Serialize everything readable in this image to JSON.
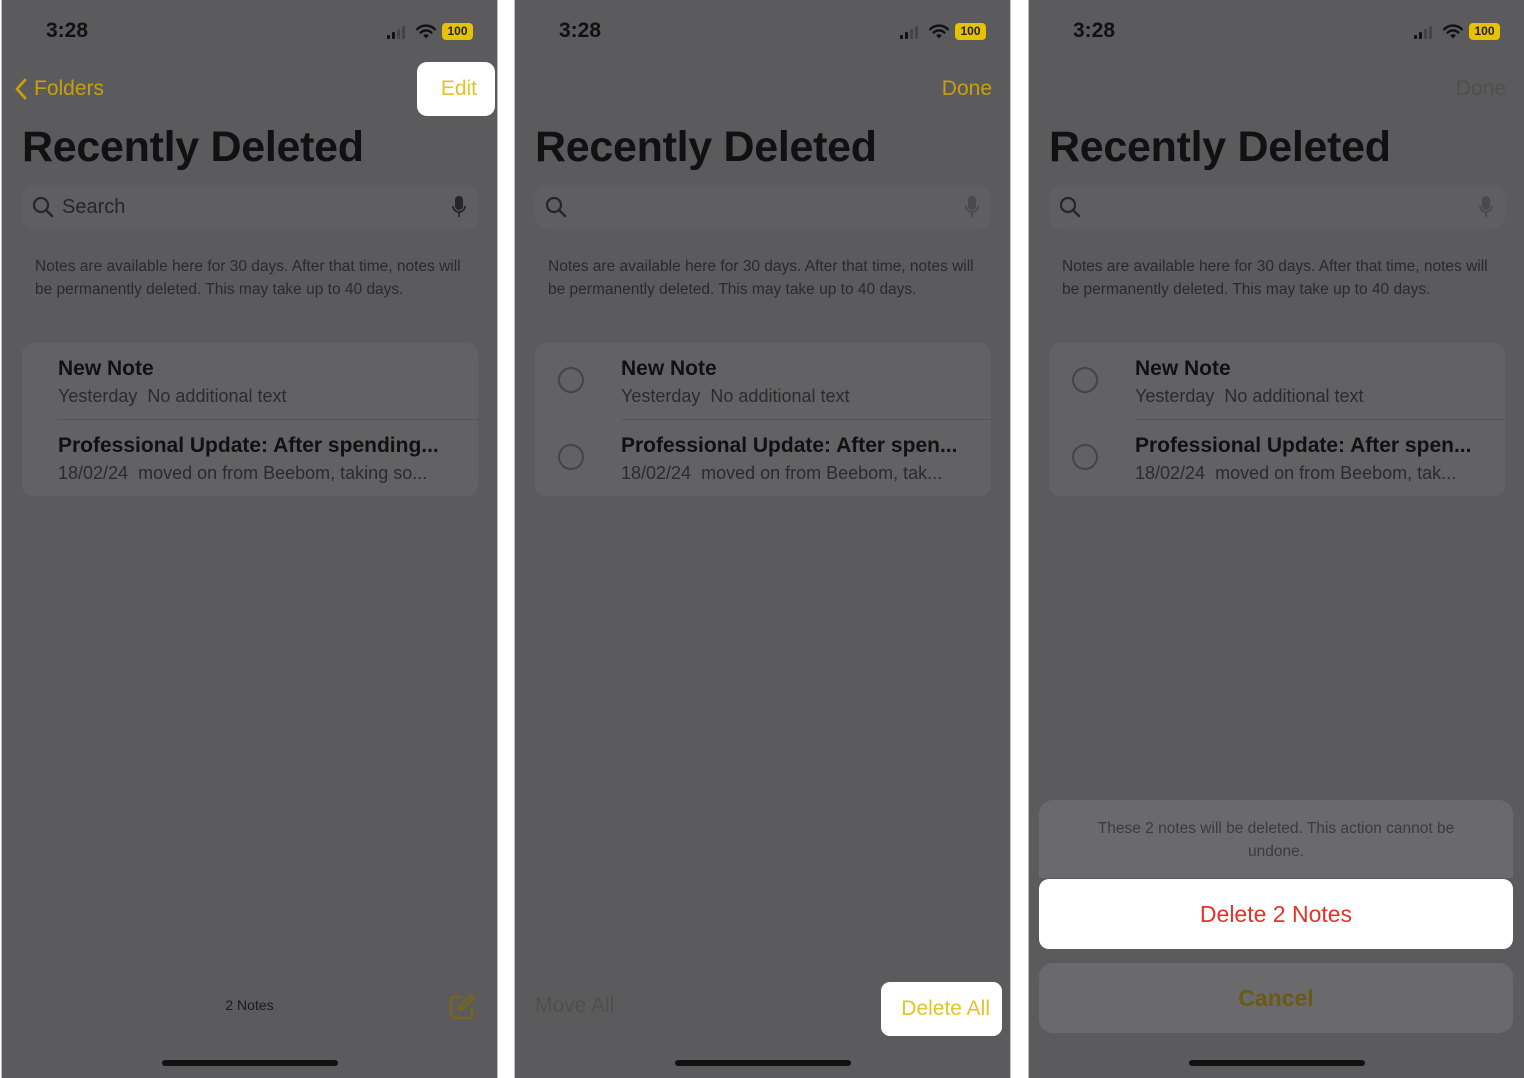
{
  "status": {
    "time": "3:28",
    "battery": "100"
  },
  "nav": {
    "back_label": "Folders",
    "edit_label": "Edit",
    "done_label": "Done"
  },
  "page": {
    "title": "Recently Deleted",
    "search_placeholder": "Search",
    "info_text": "Notes are available here for 30 days. After that time, notes will be permanently deleted. This may take up to 40 days."
  },
  "notes_full": [
    {
      "title": "New Note",
      "date": "Yesterday",
      "preview": "No additional text"
    },
    {
      "title": "Professional Update: After spending...",
      "date": "18/02/24",
      "preview": "moved on from Beebom, taking so..."
    }
  ],
  "notes_edit": [
    {
      "title": "New Note",
      "date": "Yesterday",
      "preview": "No additional text"
    },
    {
      "title": "Professional Update: After spen...",
      "date": "18/02/24",
      "preview": "moved on from Beebom, tak..."
    }
  ],
  "toolbar": {
    "count_label": "2 Notes",
    "move_all": "Move All",
    "delete_all": "Delete All"
  },
  "sheet": {
    "message": "These 2 notes will be deleted. This action cannot be undone.",
    "delete_label": "Delete 2 Notes",
    "cancel_label": "Cancel"
  },
  "icons": {
    "back": "chevron-left-icon",
    "search": "search-icon",
    "mic": "microphone-icon",
    "compose": "compose-icon",
    "signal": "cellular-signal-icon",
    "wifi": "wifi-icon",
    "battery": "battery-icon"
  },
  "colors": {
    "accent": "#e6c22a",
    "destructive": "#e6302a",
    "dim_overlay": "#5b5b5d"
  }
}
